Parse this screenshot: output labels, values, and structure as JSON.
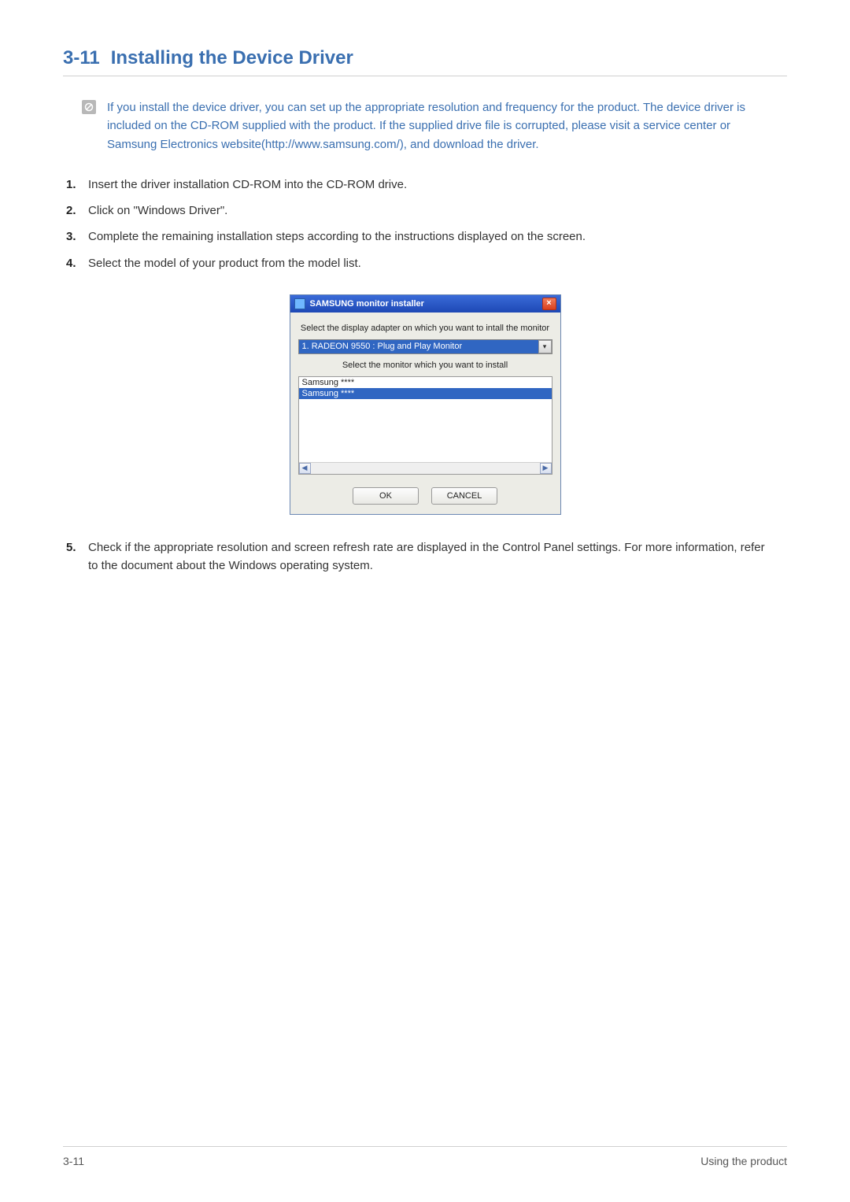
{
  "section": {
    "number": "3-11",
    "title": "Installing the Device Driver"
  },
  "note": "If you install the device driver, you can set up the appropriate resolution and frequency for the product. The device driver is included on the CD-ROM supplied with the product. If the supplied drive file is corrupted, please visit a service center or Samsung Electronics website(http://www.samsung.com/), and download the driver.",
  "steps": [
    "Insert the driver installation CD-ROM into the CD-ROM drive.",
    "Click on \"Windows Driver\".",
    "Complete the remaining installation steps according to the instructions displayed on the screen.",
    "Select the model of your product from the model list."
  ],
  "step5": "Check if the appropriate resolution and screen refresh rate are displayed in the Control Panel settings. For more information, refer to the document about the Windows operating system.",
  "installer": {
    "title": "SAMSUNG monitor installer",
    "label1": "Select the display adapter on which you want to intall the monitor",
    "adapter": "1. RADEON 9550 : Plug and Play Monitor",
    "label2": "Select the monitor which you want to install",
    "list": [
      "Samsung ****",
      "Samsung ****"
    ],
    "ok": "OK",
    "cancel": "CANCEL",
    "close": "×",
    "dropdownArrow": "▾",
    "leftArrow": "◀",
    "rightArrow": "▶"
  },
  "footer": {
    "left": "3-11",
    "right": "Using the product"
  }
}
